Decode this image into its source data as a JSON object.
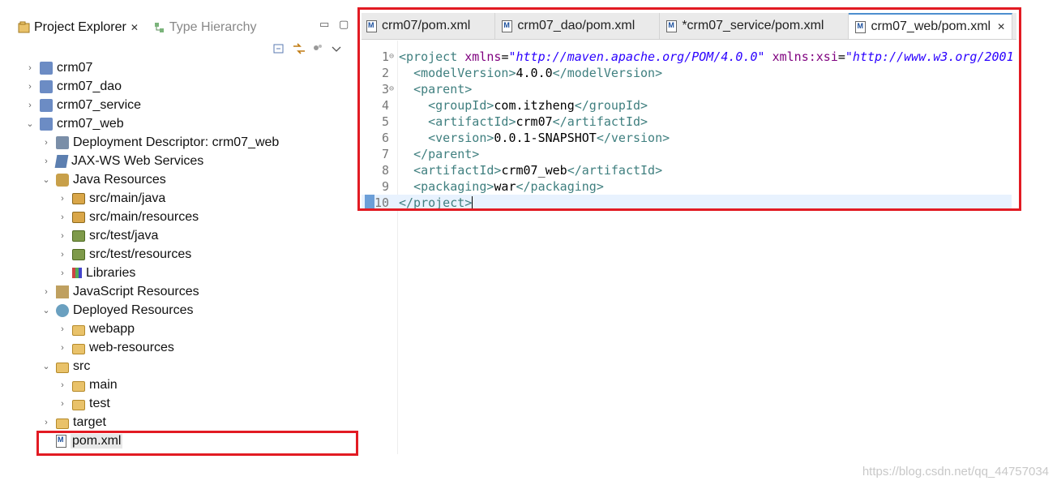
{
  "left_panel": {
    "tabs": [
      {
        "label": "Project Explorer",
        "active": true,
        "closable": true
      },
      {
        "label": "Type Hierarchy",
        "active": false
      }
    ],
    "tree": [
      {
        "label": "crm07",
        "depth": 0,
        "arrow": "›",
        "icon": "maven-project-icon"
      },
      {
        "label": "crm07_dao",
        "depth": 0,
        "arrow": "›",
        "icon": "maven-project-icon"
      },
      {
        "label": "crm07_service",
        "depth": 0,
        "arrow": "›",
        "icon": "maven-project-icon"
      },
      {
        "label": "crm07_web",
        "depth": 0,
        "arrow": "⌄",
        "icon": "maven-web-project-icon"
      },
      {
        "label": "Deployment Descriptor: crm07_web",
        "depth": 1,
        "arrow": "›",
        "icon": "deployment-descriptor-icon"
      },
      {
        "label": "JAX-WS Web Services",
        "depth": 1,
        "arrow": "›",
        "icon": "web-services-icon"
      },
      {
        "label": "Java Resources",
        "depth": 1,
        "arrow": "⌄",
        "icon": "java-resources-icon"
      },
      {
        "label": "src/main/java",
        "depth": 2,
        "arrow": "›",
        "icon": "source-folder-icon"
      },
      {
        "label": "src/main/resources",
        "depth": 2,
        "arrow": "›",
        "icon": "source-folder-icon"
      },
      {
        "label": "src/test/java",
        "depth": 2,
        "arrow": "›",
        "icon": "test-source-folder-icon"
      },
      {
        "label": "src/test/resources",
        "depth": 2,
        "arrow": "›",
        "icon": "test-source-folder-icon"
      },
      {
        "label": "Libraries",
        "depth": 2,
        "arrow": "›",
        "icon": "libraries-icon"
      },
      {
        "label": "JavaScript Resources",
        "depth": 1,
        "arrow": "›",
        "icon": "javascript-resources-icon"
      },
      {
        "label": "Deployed Resources",
        "depth": 1,
        "arrow": "⌄",
        "icon": "deployed-resources-icon"
      },
      {
        "label": "webapp",
        "depth": 2,
        "arrow": "›",
        "icon": "folder-icon"
      },
      {
        "label": "web-resources",
        "depth": 2,
        "arrow": "›",
        "icon": "folder-icon"
      },
      {
        "label": "src",
        "depth": 1,
        "arrow": "⌄",
        "icon": "folder-icon"
      },
      {
        "label": "main",
        "depth": 2,
        "arrow": "›",
        "icon": "folder-icon"
      },
      {
        "label": "test",
        "depth": 2,
        "arrow": "›",
        "icon": "folder-icon"
      },
      {
        "label": "target",
        "depth": 1,
        "arrow": "›",
        "icon": "folder-icon"
      },
      {
        "label": "pom.xml",
        "depth": 1,
        "arrow": "",
        "icon": "maven-xml-file-icon",
        "selected": true
      }
    ]
  },
  "editor": {
    "tabs": [
      {
        "label": "crm07/pom.xml",
        "active": false
      },
      {
        "label": "crm07_dao/pom.xml",
        "active": false
      },
      {
        "label": "*crm07_service/pom.xml",
        "active": false
      },
      {
        "label": "crm07_web/pom.xml",
        "active": true,
        "closable": true
      }
    ],
    "lines": [
      {
        "n": "1",
        "fold": "⊖",
        "parts": [
          [
            "t",
            "<project "
          ],
          [
            "a",
            "xmlns"
          ],
          [
            "b",
            "="
          ],
          [
            "v",
            "\"http://maven.apache.org/POM/4.0.0\""
          ],
          [
            "b",
            " "
          ],
          [
            "a",
            "xmlns:xsi"
          ],
          [
            "b",
            "="
          ],
          [
            "v",
            "\"http://www.w3.org/2001"
          ]
        ]
      },
      {
        "n": "2",
        "fold": "",
        "parts": [
          [
            "b",
            "  "
          ],
          [
            "t",
            "<modelVersion>"
          ],
          [
            "b",
            "4.0.0"
          ],
          [
            "t",
            "</modelVersion>"
          ]
        ]
      },
      {
        "n": "3",
        "fold": "⊖",
        "parts": [
          [
            "b",
            "  "
          ],
          [
            "t",
            "<parent>"
          ]
        ]
      },
      {
        "n": "4",
        "fold": "",
        "parts": [
          [
            "b",
            "    "
          ],
          [
            "t",
            "<groupId>"
          ],
          [
            "b",
            "com.itzheng"
          ],
          [
            "t",
            "</groupId>"
          ]
        ]
      },
      {
        "n": "5",
        "fold": "",
        "parts": [
          [
            "b",
            "    "
          ],
          [
            "t",
            "<artifactId>"
          ],
          [
            "b",
            "crm07"
          ],
          [
            "t",
            "</artifactId>"
          ]
        ]
      },
      {
        "n": "6",
        "fold": "",
        "parts": [
          [
            "b",
            "    "
          ],
          [
            "t",
            "<version>"
          ],
          [
            "b",
            "0.0.1-SNAPSHOT"
          ],
          [
            "t",
            "</version>"
          ]
        ]
      },
      {
        "n": "7",
        "fold": "",
        "parts": [
          [
            "b",
            "  "
          ],
          [
            "t",
            "</parent>"
          ]
        ]
      },
      {
        "n": "8",
        "fold": "",
        "parts": [
          [
            "b",
            "  "
          ],
          [
            "t",
            "<artifactId>"
          ],
          [
            "b",
            "crm07_web"
          ],
          [
            "t",
            "</artifactId>"
          ]
        ]
      },
      {
        "n": "9",
        "fold": "",
        "parts": [
          [
            "b",
            "  "
          ],
          [
            "t",
            "<packaging>"
          ],
          [
            "b",
            "war"
          ],
          [
            "t",
            "</packaging>"
          ]
        ]
      },
      {
        "n": "10",
        "fold": "",
        "current": true,
        "parts": [
          [
            "t",
            "</project>"
          ]
        ]
      }
    ]
  },
  "highlight_color": "#e21b23",
  "watermark": "https://blog.csdn.net/qq_44757034"
}
